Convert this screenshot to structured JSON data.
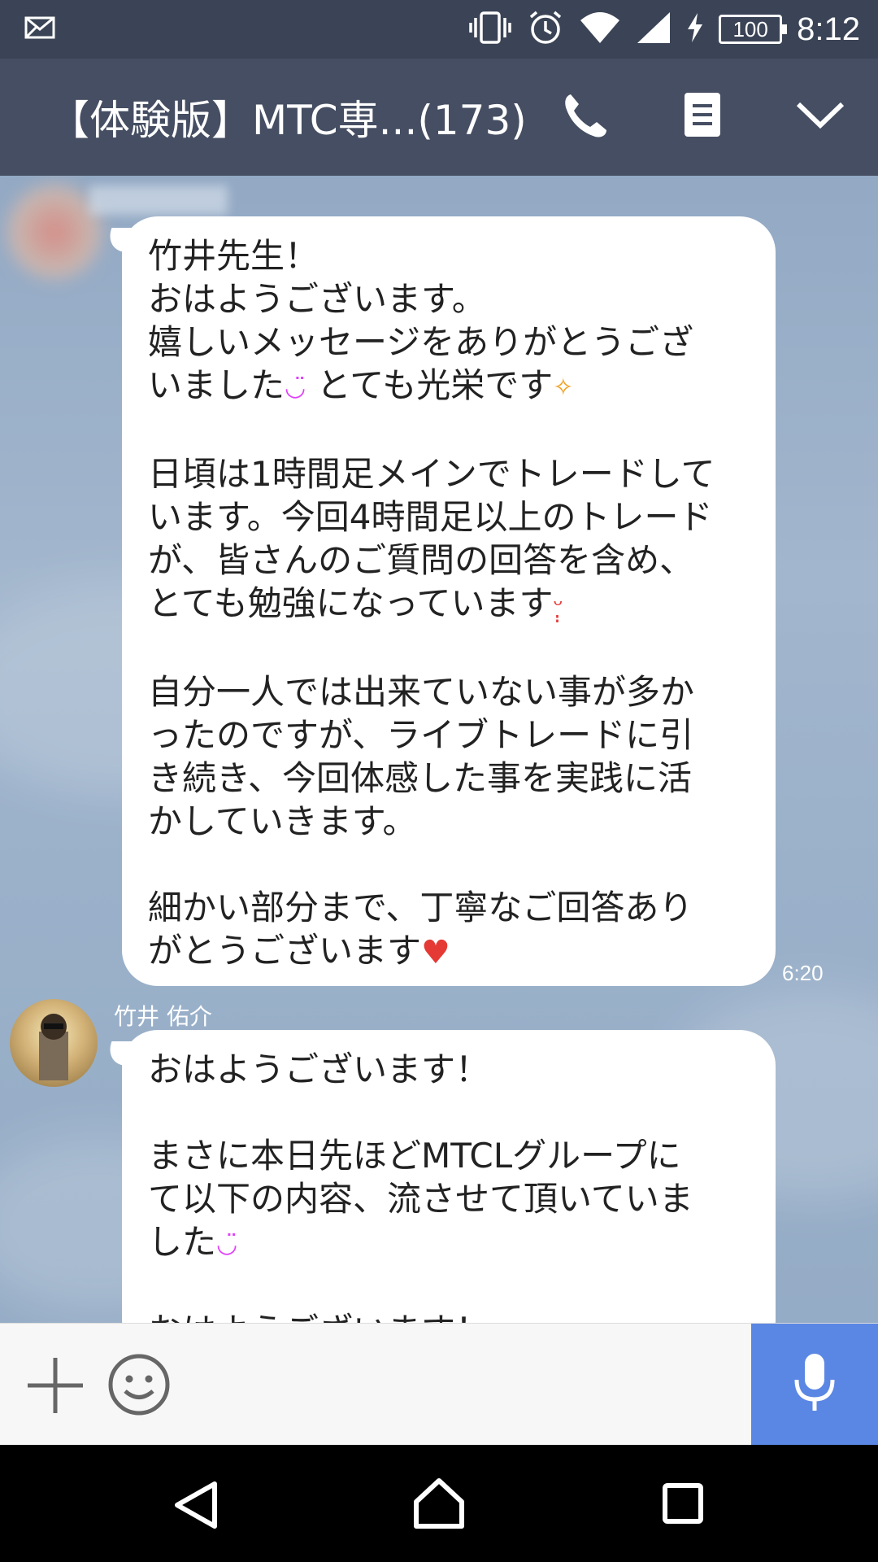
{
  "status_bar": {
    "battery": "100",
    "time": "8:12"
  },
  "header": {
    "title": "【体験版】MTC専...(173)"
  },
  "messages": {
    "incoming_1": {
      "text": "竹井先生！\nおはようございます。\n嬉しいメッセージをありがとうござ\nいました",
      "text_b": "とても光栄です",
      "text_c": "\n\n日頃は1時間足メインでトレードして\nいます。今回4時間足以上のトレード\nが、皆さんのご質問の回答を含め、\nとても勉強になっています",
      "text_d": "\n\n自分一人では出来ていない事が多か\nったのですが、ライブトレードに引\nき続き、今回体感した事を実践に活\nかしていきます。\n\n細かい部分まで、丁寧なご回答あり\nがとうございます",
      "time": "6:20"
    },
    "incoming_2": {
      "sender": "竹井 佑介",
      "text": "おはようございます！\n\nまさに本日先ほどMTCLグループに\nて以下の内容、流させて頂いていま\nした",
      "text_b": "\n\nおはようございます！"
    }
  },
  "colors": {
    "header": "#454e62",
    "status_bar": "#3b4456",
    "mic_button": "#5a87e3",
    "chat_bg": "#9bb1ca"
  }
}
